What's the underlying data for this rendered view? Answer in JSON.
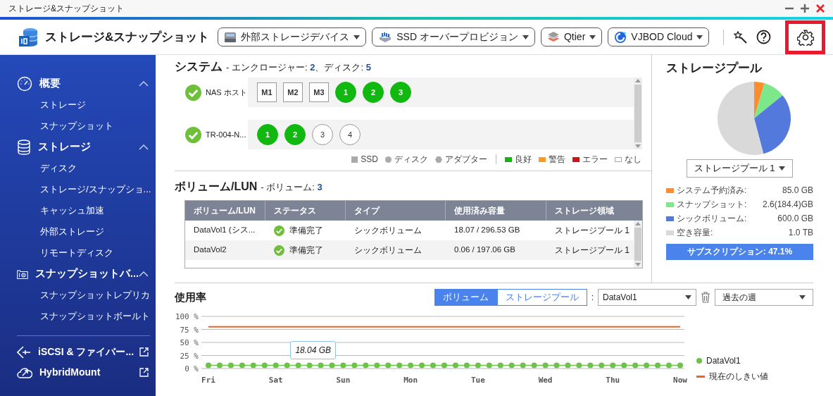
{
  "window": {
    "title": "ストレージ&スナップショット"
  },
  "toolbar": {
    "app_title": "ストレージ&スナップショット",
    "menus": [
      {
        "label": "外部ストレージデバイス"
      },
      {
        "label": "SSD オーバープロビジョン"
      },
      {
        "label": "Qtier"
      },
      {
        "label": "VJBOD Cloud"
      }
    ],
    "settings_highlighted": true
  },
  "sidebar": {
    "groups": [
      {
        "label": "概要",
        "expanded": true,
        "children": [
          {
            "label": "ストレージ"
          },
          {
            "label": "スナップショット"
          }
        ]
      },
      {
        "label": "ストレージ",
        "expanded": true,
        "children": [
          {
            "label": "ディスク"
          },
          {
            "label": "ストレージ/スナップショ..."
          },
          {
            "label": "キャッシュ加速"
          },
          {
            "label": "外部ストレージ"
          },
          {
            "label": "リモートディスク"
          }
        ]
      },
      {
        "label": "スナップショットバ...",
        "expanded": true,
        "children": [
          {
            "label": "スナップショットレプリカ"
          },
          {
            "label": "スナップショットボールト"
          }
        ]
      }
    ],
    "links": [
      {
        "label": "iSCSI & ファイバー..."
      },
      {
        "label": "HybridMount"
      }
    ]
  },
  "system": {
    "title": "システム",
    "subtitle_prefix": "- エンクロージャー: ",
    "enclosures": "2",
    "subtitle_mid": "、ディスク: ",
    "disks": "5",
    "enclosure_rows": [
      {
        "name": "NAS ホスト",
        "healthy": true,
        "slots": [
          {
            "label": "M1",
            "kind": "ssd",
            "good": false
          },
          {
            "label": "M2",
            "kind": "ssd",
            "good": false
          },
          {
            "label": "M3",
            "kind": "ssd",
            "good": false
          },
          {
            "label": "1",
            "kind": "disk",
            "good": true
          },
          {
            "label": "2",
            "kind": "disk",
            "good": true
          },
          {
            "label": "3",
            "kind": "disk",
            "good": true
          }
        ]
      },
      {
        "name": "TR-004-N...",
        "healthy": true,
        "slots": [
          {
            "label": "1",
            "kind": "disk",
            "good": true
          },
          {
            "label": "2",
            "kind": "disk",
            "good": true
          },
          {
            "label": "3",
            "kind": "disk",
            "good": false
          },
          {
            "label": "4",
            "kind": "disk",
            "good": false
          }
        ]
      }
    ],
    "legend_types": [
      {
        "label": "SSD",
        "kind": "ssd"
      },
      {
        "label": "ディスク",
        "kind": "disk"
      },
      {
        "label": "アダプター",
        "kind": "adapter"
      }
    ],
    "legend_states": [
      {
        "label": "良好",
        "color": "#11b611"
      },
      {
        "label": "警告",
        "color": "#ff9a1f"
      },
      {
        "label": "エラー",
        "color": "#cc1414"
      },
      {
        "label": "なし",
        "color": "#ffffff"
      }
    ]
  },
  "volumes": {
    "title": "ボリューム/LUN",
    "subtitle_prefix": "- ボリューム: ",
    "count": "3",
    "columns": [
      "ボリューム/LUN",
      "ステータス",
      "タイプ",
      "使用済み容量",
      "ストレージ領域"
    ],
    "rows": [
      {
        "name": "DataVol1 (シス...",
        "status": "準備完了",
        "type": "シックボリューム",
        "used": "18.07 / 296.53 GB",
        "pool": "ストレージプール 1"
      },
      {
        "name": "DataVol2",
        "status": "準備完了",
        "type": "シックボリューム",
        "used": "0.06 / 197.06 GB",
        "pool": "ストレージプール 1"
      }
    ]
  },
  "storage_pool": {
    "title": "ストレージプール",
    "chart_data": {
      "type": "pie",
      "categories": [
        "システム予約済み",
        "スナップショット",
        "シックボリューム",
        "空き容量"
      ],
      "values": [
        4.5,
        9.7,
        31.7,
        54.1
      ]
    },
    "selector": "ストレージプール 1",
    "legend_separator": ":",
    "legend": [
      {
        "value": "85.0 GB",
        "color": "#ff8c2e"
      },
      {
        "value": "2.6(184.4)GB",
        "color": "#7ce88a"
      },
      {
        "value": "600.0 GB",
        "color": "#5479dd"
      },
      {
        "value": "1.0 TB",
        "color": "#d9d9d9"
      }
    ],
    "subscription": "サブスクリプション: 47.1%"
  },
  "usage": {
    "title": "使用率",
    "tabs": [
      {
        "label": "ボリューム",
        "selected": true
      },
      {
        "label": "ストレージプール",
        "selected": false
      }
    ],
    "separator": ":",
    "volume_select": "DataVol1",
    "period_select": "過去の週",
    "chart_data": {
      "type": "line",
      "categories": [
        "Fri",
        null,
        null,
        null,
        null,
        null,
        "Sat",
        null,
        null,
        null,
        null,
        null,
        "Sun",
        null,
        null,
        null,
        null,
        null,
        "Mon",
        null,
        null,
        null,
        null,
        null,
        "Tue",
        null,
        null,
        null,
        null,
        null,
        "Wed",
        null,
        null,
        null,
        null,
        null,
        "Thu",
        null,
        null,
        null,
        null,
        null,
        "Now"
      ],
      "annotations": [
        "18.04 GB"
      ],
      "grid": true,
      "ylim": [
        0,
        100
      ],
      "yticks": [
        {
          "value": 0,
          "label": "0 %"
        },
        {
          "value": 25,
          "label": "25 %"
        },
        {
          "value": 50,
          "label": "50 %"
        },
        {
          "value": 75,
          "label": "75 %"
        },
        {
          "value": 100,
          "label": "100 %"
        }
      ],
      "series": [
        {
          "name": "DataVol1",
          "color": "#6cc24a",
          "marker": "circle",
          "values": [
            6,
            6,
            6,
            6,
            6,
            6,
            6,
            6,
            6,
            6,
            6,
            6,
            6,
            6,
            6,
            6,
            6,
            6,
            6,
            6,
            6,
            6,
            6,
            6,
            6,
            6,
            6,
            6,
            6,
            6,
            6,
            6,
            6,
            6,
            6,
            6,
            6,
            6,
            6,
            6,
            6,
            6,
            6
          ]
        },
        {
          "name": "現在のしきい値",
          "color": "#f06423",
          "values": [
            80,
            80,
            80,
            80,
            80,
            80,
            80,
            80,
            80,
            80,
            80,
            80,
            80,
            80,
            80,
            80,
            80,
            80,
            80,
            80,
            80,
            80,
            80,
            80,
            80,
            80,
            80,
            80,
            80,
            80,
            80,
            80,
            80,
            80,
            80,
            80,
            80,
            80,
            80,
            80,
            80,
            80,
            80
          ]
        }
      ]
    }
  }
}
